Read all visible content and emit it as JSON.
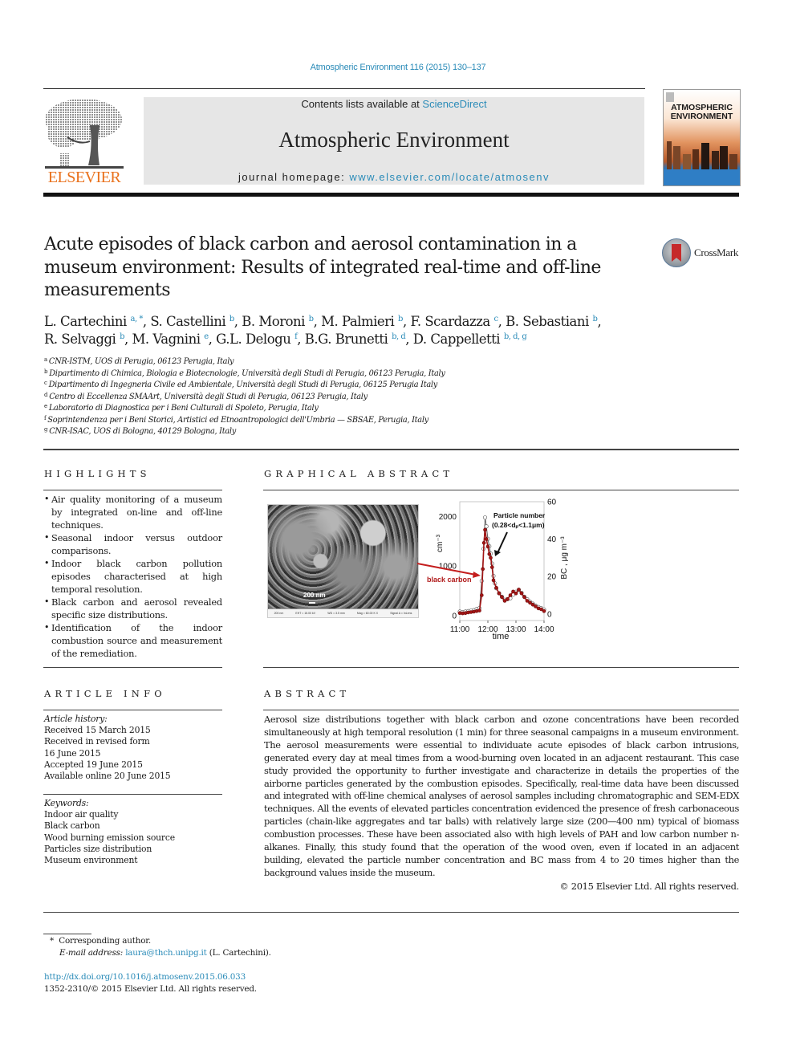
{
  "header": {
    "citation": "Atmospheric Environment 116 (2015) 130–137",
    "contents_prefix": "Contents lists available at ",
    "contents_link": "ScienceDirect",
    "journal_title": "Atmospheric Environment",
    "homepage_prefix": "journal homepage: ",
    "homepage_link": "www.elsevier.com/locate/atmosenv",
    "publisher_logo_text": "ELSEVIER",
    "cover_title_line1": "ATMOSPHERIC",
    "cover_title_line2": "ENVIRONMENT",
    "crossmark_label": "CrossMark"
  },
  "article": {
    "title": "Acute episodes of black carbon and aerosol contamination in a museum environment: Results of integrated real-time and off-line measurements",
    "authors": [
      {
        "name": "L. Cartechini",
        "aff": "a, *"
      },
      {
        "name": "S. Castellini",
        "aff": "b"
      },
      {
        "name": "B. Moroni",
        "aff": "b"
      },
      {
        "name": "M. Palmieri",
        "aff": "b"
      },
      {
        "name": "F. Scardazza",
        "aff": "c"
      },
      {
        "name": "B. Sebastiani",
        "aff": "b"
      },
      {
        "name": "R. Selvaggi",
        "aff": "b"
      },
      {
        "name": "M. Vagnini",
        "aff": "e"
      },
      {
        "name": "G.L. Delogu",
        "aff": "f"
      },
      {
        "name": "B.G. Brunetti",
        "aff": "b, d"
      },
      {
        "name": "D. Cappelletti",
        "aff": "b, d, g"
      }
    ],
    "affiliations": [
      {
        "key": "a",
        "text": "CNR-ISTM, UOS di Perugia, 06123 Perugia, Italy"
      },
      {
        "key": "b",
        "text": "Dipartimento di Chimica, Biologia e Biotecnologie, Università degli Studi di Perugia, 06123 Perugia, Italy"
      },
      {
        "key": "c",
        "text": "Dipartimento di Ingegneria Civile ed Ambientale, Università degli Studi di Perugia, 06125 Perugia Italy"
      },
      {
        "key": "d",
        "text": "Centro di Eccellenza SMAArt, Università degli Studi di Perugia, 06123 Perugia, Italy"
      },
      {
        "key": "e",
        "text": "Laboratorio di Diagnostica per i Beni Culturali di Spoleto, Perugia, Italy"
      },
      {
        "key": "f",
        "text": "Soprintendenza per i Beni Storici, Artistici ed Etnoantropologici dell'Umbria — SBSAE, Perugia, Italy"
      },
      {
        "key": "g",
        "text": "CNR-ISAC, UOS di Bologna, 40129 Bologna, Italy"
      }
    ]
  },
  "highlights": {
    "heading": "HIGHLIGHTS",
    "items": [
      "Air quality monitoring of a museum by integrated on-line and off-line techniques.",
      "Seasonal indoor versus outdoor comparisons.",
      "Indoor black carbon pollution episodes characterised at high temporal resolution.",
      "Black carbon and aerosol revealed specific size distributions.",
      "Identification of the indoor combustion source and measurement of the remediation."
    ]
  },
  "graphical_abstract": {
    "heading": "GRAPHICAL ABSTRACT",
    "sem_scale_label": "200 nm",
    "sem_info": [
      "200 nm",
      "EHT = 15.00 kV",
      "WD = 3.5 mm",
      "Mag = 60.00 K X",
      "Signal A = InLens"
    ],
    "arrow_label": "black carbon"
  },
  "chart_data": {
    "type": "line",
    "title": "",
    "xlabel": "time",
    "ylabel_left": "cm⁻³",
    "ylabel_right": "BC , μg m⁻³",
    "x_ticks": [
      "11:00",
      "12:00",
      "13:00",
      "14:00"
    ],
    "x_range_hours": [
      11.0,
      14.0
    ],
    "y_left_ticks": [
      0,
      1000,
      2000
    ],
    "y_left_range": [
      -100,
      2300
    ],
    "y_right_ticks": [
      0,
      20,
      40,
      60
    ],
    "y_right_range": [
      -3.5,
      60
    ],
    "annotations": [
      "Particle number",
      "(0.28<dₚ<1.1μm)",
      "black carbon"
    ],
    "series": [
      {
        "name": "Particle number (0.28<dp<1.1μm)",
        "axis": "left",
        "color": "#ffffff",
        "stroke": "#555555",
        "x": [
          11.0,
          11.1,
          11.2,
          11.3,
          11.4,
          11.5,
          11.6,
          11.7,
          11.78,
          11.85,
          11.9,
          11.95,
          12.0,
          12.05,
          12.1,
          12.15,
          12.2,
          12.25,
          12.3,
          12.4,
          12.5,
          12.6,
          12.7,
          12.8,
          12.9,
          13.0,
          13.1,
          13.2,
          13.3,
          13.4,
          13.5,
          13.6,
          13.7,
          13.8,
          13.9,
          14.0
        ],
        "y": [
          80,
          70,
          80,
          90,
          100,
          110,
          130,
          150,
          700,
          1350,
          1980,
          1800,
          1550,
          1400,
          1250,
          1050,
          800,
          650,
          550,
          450,
          380,
          320,
          330,
          350,
          420,
          480,
          520,
          460,
          380,
          330,
          280,
          240,
          200,
          170,
          150,
          120
        ]
      },
      {
        "name": "black carbon",
        "axis": "right",
        "color": "#a31515",
        "x": [
          11.0,
          11.1,
          11.2,
          11.3,
          11.4,
          11.5,
          11.6,
          11.7,
          11.78,
          11.82,
          11.86,
          11.9,
          11.95,
          12.0,
          12.05,
          12.1,
          12.15,
          12.2,
          12.3,
          12.4,
          12.5,
          12.6,
          12.7,
          12.8,
          12.9,
          13.0,
          13.1,
          13.2,
          13.3,
          13.4,
          13.5,
          13.6,
          13.7,
          13.8,
          13.9,
          14.0
        ],
        "y": [
          0.5,
          0.3,
          0.5,
          0.8,
          1.0,
          1.2,
          1.5,
          1.8,
          10,
          24,
          38,
          45,
          40,
          36,
          32,
          30,
          25,
          18,
          14,
          11,
          9,
          7,
          8,
          10,
          12,
          11,
          13,
          11,
          9,
          7,
          6,
          5,
          4,
          3,
          2.5,
          1.5
        ]
      }
    ]
  },
  "article_info": {
    "heading": "ARTICLE INFO",
    "history_label": "Article history:",
    "history": [
      "Received 15 March 2015",
      "Received in revised form",
      "16 June 2015",
      "Accepted 19 June 2015",
      "Available online 20 June 2015"
    ],
    "keywords_label": "Keywords:",
    "keywords": [
      "Indoor air quality",
      "Black carbon",
      "Wood burning emission source",
      "Particles size distribution",
      "Museum environment"
    ]
  },
  "abstract": {
    "heading": "ABSTRACT",
    "text": "Aerosol size distributions together with black carbon and ozone concentrations have been recorded simultaneously at high temporal resolution (1 min) for three seasonal campaigns in a museum envi­ronment. The aerosol measurements were essential to individuate acute episodes of black carbon in­trusions, generated every day at meal times from a wood-burning oven located in an adjacent restaurant. This case study provided the opportunity to further investigate and characterize in details the properties of the airborne particles generated by the combustion episodes. Specifically, real-time data have been discussed and integrated with off-line chemical analyses of aerosol samples including chromatographic and SEM-EDX techniques. All the events of elevated particles concentration evidenced the presence of fresh carbonaceous particles (chain-like aggregates and tar balls) with relatively large size (200—400 nm) typical of biomass combustion processes. These have been associated also with high levels of PAH and low carbon number n-alkanes. Finally, this study found that the operation of the wood oven, even if located in an adjacent building, elevated the particle number concentration and BC mass from 4 to 20 times higher than the background values inside the museum.",
    "copyright": "© 2015 Elsevier Ltd. All rights reserved."
  },
  "footer": {
    "corresponding_marker": "*",
    "corresponding_label": "Corresponding author.",
    "email_label": "E-mail address:",
    "email": "laura@thch.unipg.it",
    "email_suffix": "(L. Cartechini).",
    "doi": "http://dx.doi.org/10.1016/j.atmosenv.2015.06.033",
    "issn_line": "1352-2310/© 2015 Elsevier Ltd. All rights reserved."
  }
}
